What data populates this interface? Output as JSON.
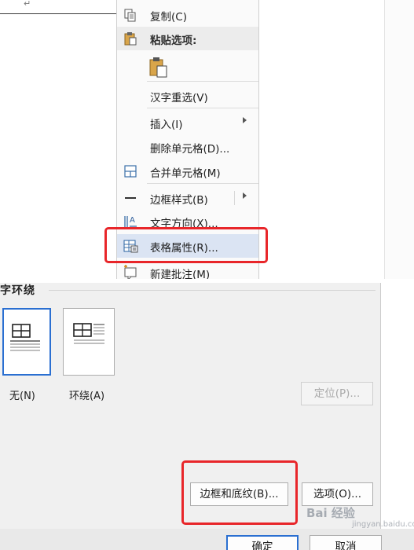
{
  "context_menu": {
    "copy": "复制(C)",
    "paste_options_header": "粘贴选项:",
    "hanzi_reselect": "汉字重选(V)",
    "insert": "插入(I)",
    "delete_cells": "删除单元格(D)...",
    "merge_cells": "合并单元格(M)",
    "border_styles": "边框样式(B)",
    "text_direction": "文字方向(X)...",
    "table_properties": "表格属性(R)...",
    "new_comment": "新建批注(M)"
  },
  "dialog": {
    "text_wrapping_group": "字环绕",
    "wrap_none": "无(N)",
    "wrap_around": "环绕(A)",
    "positioning_button": "定位(P)...",
    "borders_shading_button": "边框和底纹(B)...",
    "options_button": "选项(O)...",
    "ok_button": "确定",
    "cancel_button": "取消"
  },
  "watermark": {
    "text": "Bai 经验",
    "sub": "jingyan.baidu.com"
  },
  "colors": {
    "highlight_box": "#e8262a",
    "selected_border": "#2a6fd1",
    "menu_hover": "#dbe4f3"
  }
}
